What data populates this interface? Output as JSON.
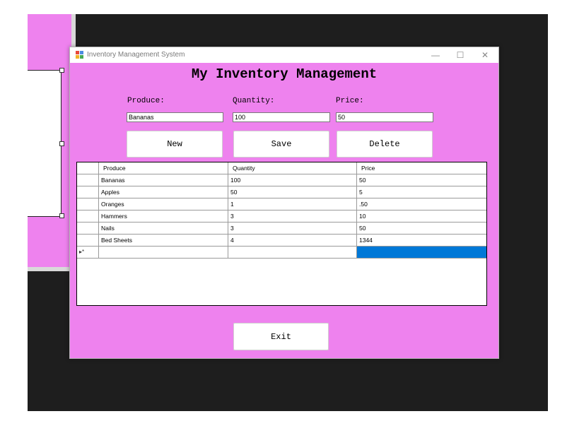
{
  "window": {
    "title": "Inventory Management System",
    "controls": {
      "minimize": "—",
      "maximize": "☐",
      "close": "✕"
    }
  },
  "heading": "My Inventory Management",
  "form": {
    "produce_label": "Produce:",
    "quantity_label": "Quantity:",
    "price_label": "Price:",
    "produce_value": "Bananas",
    "quantity_value": "100",
    "price_value": "50"
  },
  "buttons": {
    "new": "New",
    "save": "Save",
    "delete": "Delete",
    "exit": "Exit"
  },
  "grid": {
    "columns": [
      "Produce",
      "Quantity",
      "Price"
    ],
    "rows": [
      [
        "Bananas",
        "100",
        "50"
      ],
      [
        "Apples",
        "50",
        "5"
      ],
      [
        "Oranges",
        "1",
        ".50"
      ],
      [
        "Hammers",
        "3",
        "10"
      ],
      [
        "Nails",
        "3",
        "50"
      ],
      [
        "Bed Sheets",
        "4",
        "1344"
      ]
    ],
    "new_row_marker": "▸*"
  },
  "colors": {
    "form_background": "#ee82ee",
    "selection": "#0078d7"
  }
}
